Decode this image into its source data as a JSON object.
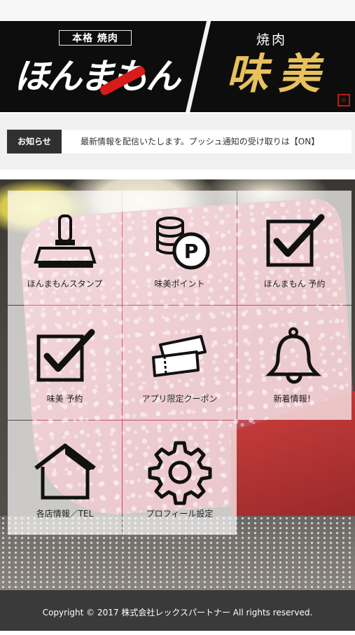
{
  "banner": {
    "left_tag": "本格 焼肉",
    "left_title": "ほんまもん",
    "right_small": "焼肉",
    "right_title": "味美"
  },
  "news": {
    "label": "お知らせ",
    "text": "最新情報を配信いたします。プッシュ通知の受け取りは【ON】"
  },
  "menu": [
    {
      "label": "ほんまもんスタンプ",
      "icon": "stamp-icon"
    },
    {
      "label": "味美ポイント",
      "icon": "coins-point-icon"
    },
    {
      "label": "ほんまもん 予約",
      "icon": "checkbox-icon"
    },
    {
      "label": "味美 予約",
      "icon": "checkbox-icon"
    },
    {
      "label": "アプリ限定クーポン",
      "icon": "coupon-icon"
    },
    {
      "label": "新着情報！",
      "icon": "bell-icon"
    },
    {
      "label": "各店情報／TEL",
      "icon": "house-icon"
    },
    {
      "label": "プロフィール設定",
      "icon": "gear-icon"
    }
  ],
  "footer": {
    "copyright": "Copyright © 2017 株式会社レックスパートナー All rights reserved."
  }
}
